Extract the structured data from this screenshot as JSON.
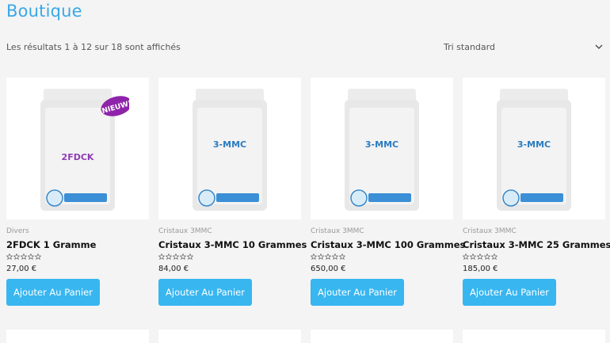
{
  "page": {
    "title": "Boutique",
    "result_count": "Les résultats 1 à 12 sur 18 sont affichés",
    "sort_label": "Tri standard"
  },
  "products": [
    {
      "category": "Divers",
      "name": "2FDCK 1 Gramme",
      "price": "27,00 €",
      "button": "Ajouter Au Panier",
      "pack_label": "2FDCK",
      "pack_label_color": "#8e3bb5",
      "badge": "NIEUW!"
    },
    {
      "category": "Cristaux 3MMC",
      "name": "Cristaux 3-MMC 10 Grammes",
      "price": "84,00 €",
      "button": "Ajouter Au Panier",
      "pack_label": "3-MMC",
      "pack_label_color": "#2b7bc0"
    },
    {
      "category": "Cristaux 3MMC",
      "name": "Cristaux 3-MMC 100 Grammes",
      "price": "650,00 €",
      "button": "Ajouter Au Panier",
      "pack_label": "3-MMC",
      "pack_label_color": "#2b7bc0"
    },
    {
      "category": "Cristaux 3MMC",
      "name": "Cristaux 3-MMC 25 Grammes",
      "price": "185,00 €",
      "button": "Ajouter Au Panier",
      "pack_label": "3-MMC",
      "pack_label_color": "#2b7bc0"
    }
  ],
  "colors": {
    "accent": "#38b6f0",
    "title": "#3aa8e6",
    "badge": "#8e24aa"
  },
  "icons": {
    "sort": "chevron-down-icon",
    "rating": "star-outline-icon"
  }
}
